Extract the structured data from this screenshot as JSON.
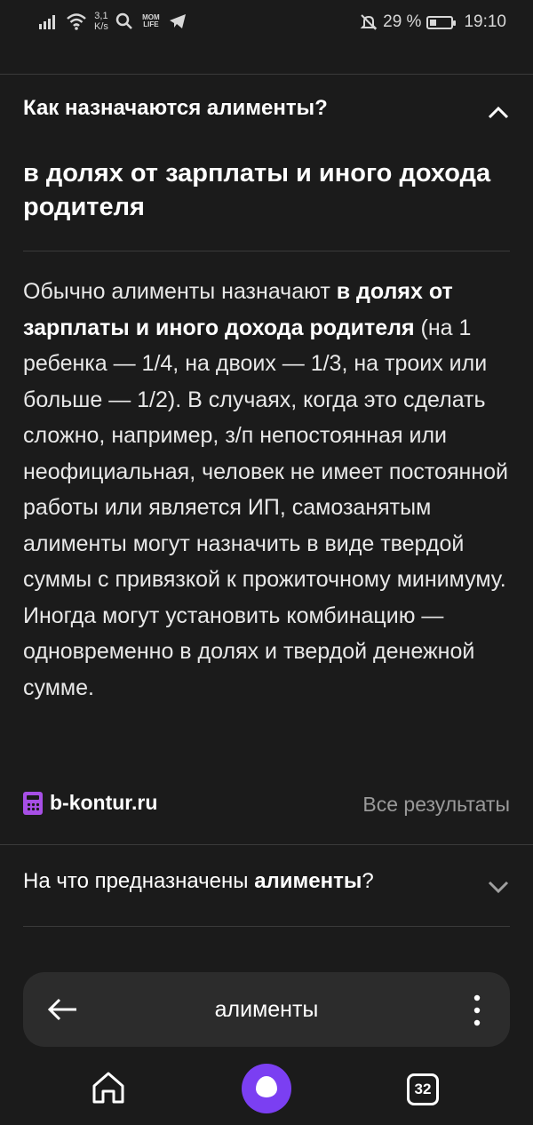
{
  "status_bar": {
    "speed_value": "3,1",
    "speed_unit": "K/s",
    "app_badge": "MOM LIFE",
    "battery_percent": "29 %",
    "time": "19:10"
  },
  "faq_expanded": {
    "question": "Как назначаются алименты?",
    "short_answer": "в долях от зарплаты и иного дохода родителя",
    "body_intro": "Обычно алименты назначают ",
    "body_bold": "в долях от зарплаты и иного дохода родителя",
    "body_rest": " (на 1 ребенка — 1/4, на двоих — 1/3, на троих или больше — 1/2). В случаях, когда это сделать сложно, например, з/п непостоянная или неофициальная, человек не имеет постоянной работы или является ИП, самозанятым алименты могут назначить в виде твердой суммы с привязкой к прожиточному минимуму. Иногда могут установить комбинацию — одновременно в долях и твердой денежной сумме.",
    "source_name": "b-kontur.ru",
    "all_results_label": "Все результаты"
  },
  "faq_collapsed": {
    "question_prefix": "На что предназначены ",
    "question_bold": "алименты",
    "question_suffix": "?"
  },
  "search_bar": {
    "query": "алименты"
  },
  "nav_bar": {
    "tabs_count": "32"
  }
}
